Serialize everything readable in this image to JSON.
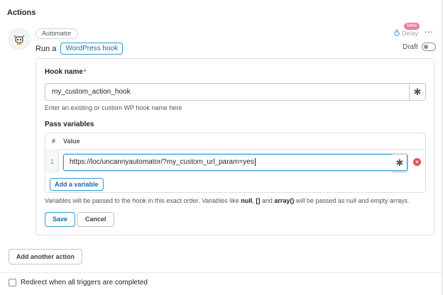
{
  "header": {
    "title": "Actions"
  },
  "action": {
    "integration_label": "Automator",
    "sentence_prefix": "Run a",
    "sentence_token": "WordPress hook",
    "new_badge": "New",
    "delay_label": "Delay",
    "more_icon": "⋯",
    "draft_label": "Draft"
  },
  "form": {
    "hook_name_label": "Hook name",
    "required_mark": "*",
    "hook_name_value": "my_custom_action_hook",
    "hook_name_help": "Enter an existing or custom WP hook name here",
    "pass_variables_label": "Pass variables",
    "table": {
      "headers": [
        "#",
        "Value"
      ],
      "rows": [
        {
          "num": "1",
          "value": "https://loc/uncannyautomator/?my_custom_url_param=yes"
        }
      ]
    },
    "add_variable_label": "Add a variable",
    "vars_help": {
      "t1": "Variables will be passed to the hook in this exact order. Variables like ",
      "b1": "null",
      "t2": ", ",
      "b2": "[]",
      "t3": " and ",
      "b3": "array()",
      "t4": " will be passed as null and empty arrays."
    },
    "save_label": "Save",
    "cancel_label": "Cancel"
  },
  "footer": {
    "add_action_label": "Add another action",
    "redirect_label": "Redirect when all triggers are completed"
  },
  "colors": {
    "accent": "#2e9ad8",
    "danger": "#e65054",
    "badge": "#f27ba1"
  }
}
